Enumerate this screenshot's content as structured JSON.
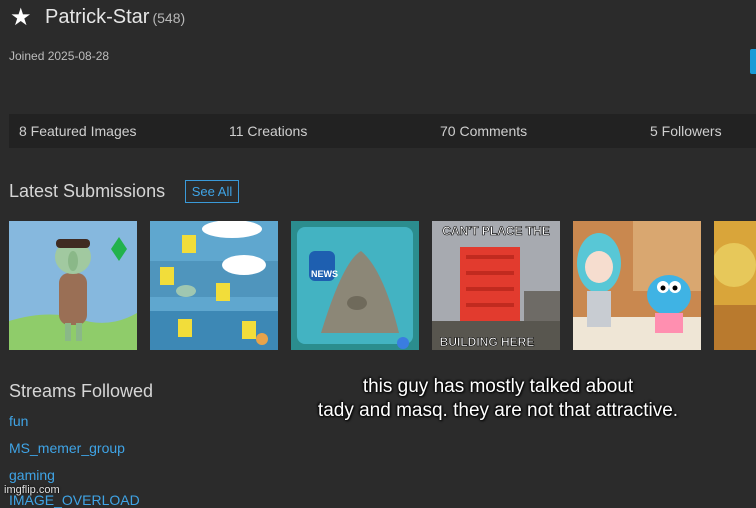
{
  "profile": {
    "username": "Patrick-Star",
    "points": "(548)",
    "joined": "Joined 2025-08-28"
  },
  "stats": {
    "featured": "8 Featured Images",
    "creations": "11 Creations",
    "comments": "70 Comments",
    "followers": "5 Followers"
  },
  "submissions": {
    "title": "Latest Submissions",
    "see_all": "See All",
    "thumb_texts": {
      "building_top": "CAN'T PLACE THE",
      "building_bottom": "BUILDING HERE",
      "news_logo": "NEWS"
    }
  },
  "streams": {
    "title": "Streams Followed",
    "items": [
      "fun",
      "MS_memer_group",
      "gaming",
      "IMAGE_OVERLOAD"
    ]
  },
  "caption": {
    "line1": "this guy has mostly talked about",
    "line2": "tady and masq. they are not that attractive."
  },
  "watermark": "imgflip.com",
  "colors": {
    "background": "#2b2b2b",
    "stats_bar": "#222222",
    "link": "#3fa4e6",
    "accent_button": "#1a9bd7"
  }
}
